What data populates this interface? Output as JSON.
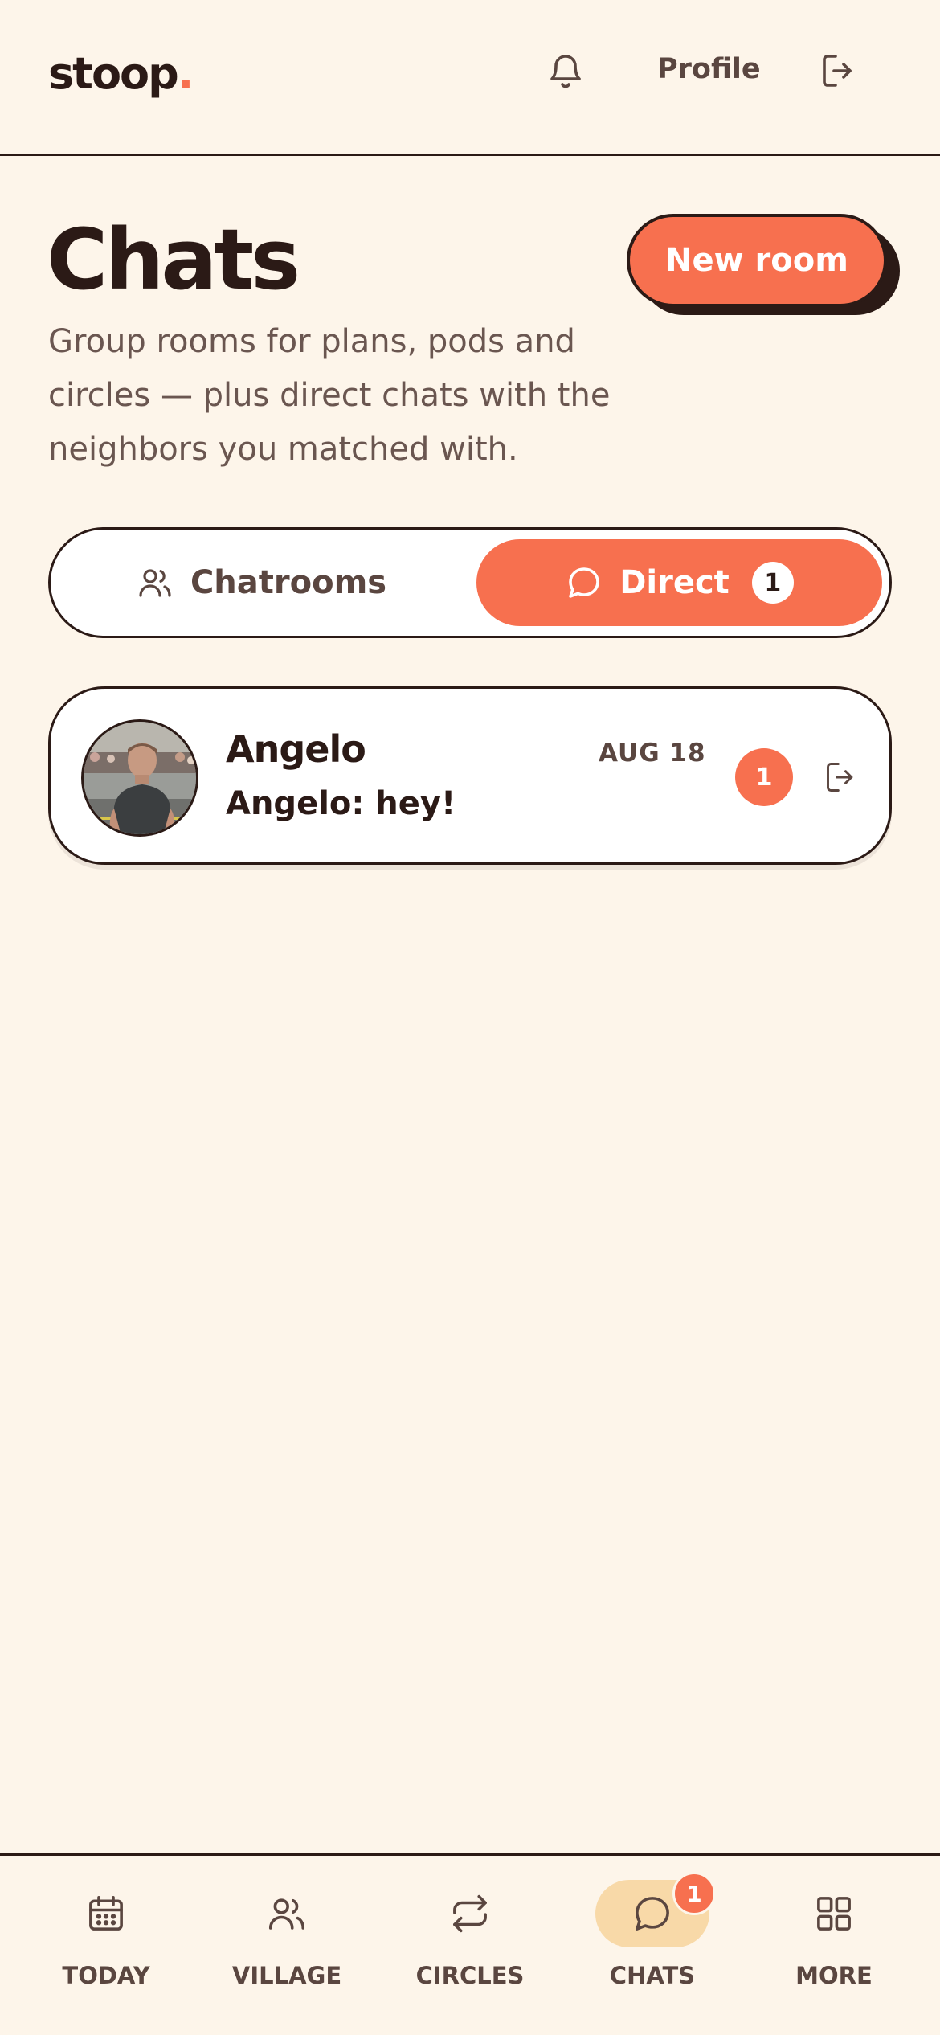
{
  "header": {
    "logo_text": "stoop",
    "logo_dot": ".",
    "profile_label": "Profile"
  },
  "page": {
    "title": "Chats",
    "subtitle": "Group rooms for plans, pods and circles — plus direct chats with the neighbors you matched with.",
    "new_room_label": "New room"
  },
  "tabs": {
    "chatrooms_label": "Chatrooms",
    "direct_label": "Direct",
    "direct_badge": "1",
    "active": "Direct"
  },
  "chats": [
    {
      "name": "Angelo",
      "preview": "Angelo: hey!",
      "date": "AUG 18",
      "unread": "1"
    }
  ],
  "nav": {
    "items": [
      {
        "label": "TODAY",
        "icon": "calendar-icon"
      },
      {
        "label": "VILLAGE",
        "icon": "people-icon"
      },
      {
        "label": "CIRCLES",
        "icon": "repeat-icon"
      },
      {
        "label": "CHATS",
        "icon": "chat-bubble-icon",
        "badge": "1",
        "active": true
      },
      {
        "label": "MORE",
        "icon": "grid-icon"
      }
    ]
  },
  "colors": {
    "accent": "#f7704f",
    "background": "#fdf5ea",
    "ink": "#2b1a16",
    "active_nav_pill": "#f8d9a8"
  }
}
